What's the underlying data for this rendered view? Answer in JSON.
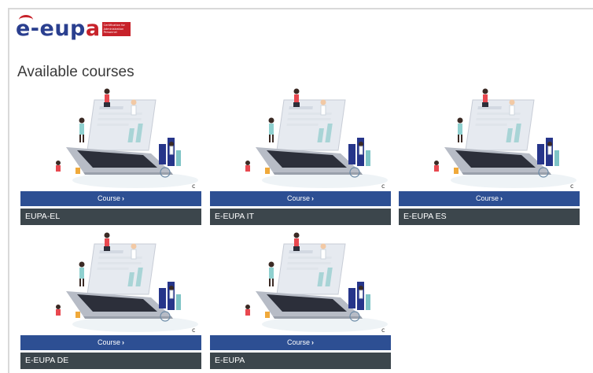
{
  "logo": {
    "text_main": "e-eup",
    "text_accent": "a",
    "badge": "Certification for Administration Personnel"
  },
  "heading": "Available courses",
  "courses": [
    {
      "button": "Course",
      "title": "EUPA-EL"
    },
    {
      "button": "Course",
      "title": "E-EUPA IT"
    },
    {
      "button": "Course",
      "title": "E-EUPA ES"
    },
    {
      "button": "Course",
      "title": "E-EUPA DE"
    },
    {
      "button": "Course",
      "title": "E-EUPA"
    }
  ],
  "icons": {
    "chevron": "chevron-right-icon"
  },
  "colors": {
    "button": "#2d4f93",
    "title_bar": "#3c464c",
    "brand_blue": "#2a3f8f",
    "brand_red": "#c7222a"
  }
}
